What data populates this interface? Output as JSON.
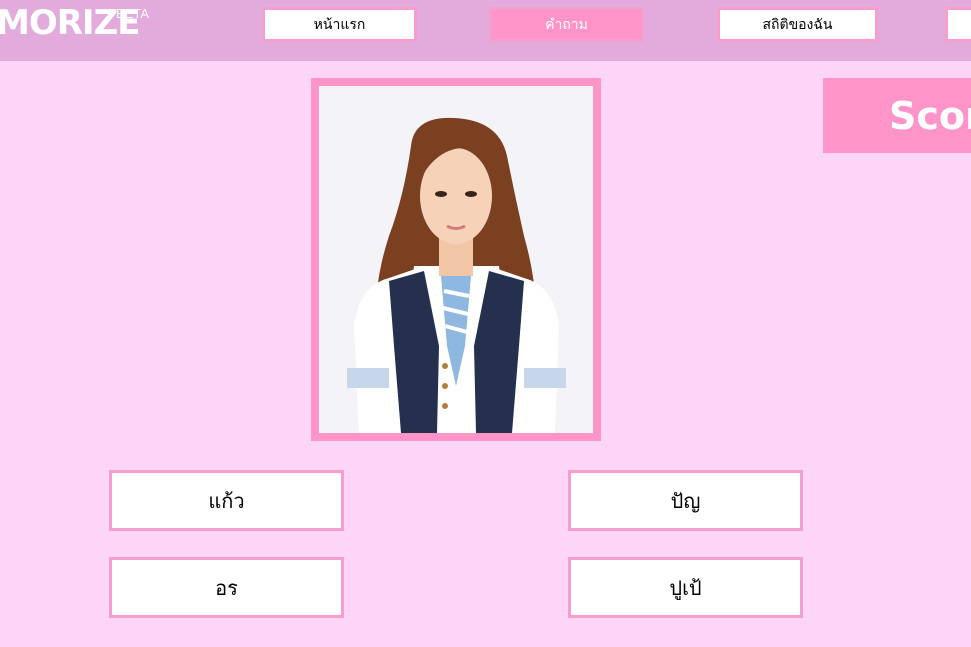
{
  "header": {
    "logo_text": "MORIZE",
    "logo_badge": "BETA",
    "nav": [
      {
        "label": "หน้าแรก",
        "active": false
      },
      {
        "label": "คำถาม",
        "active": true
      },
      {
        "label": "สถิติของฉัน",
        "active": false
      },
      {
        "label": "",
        "active": false
      }
    ]
  },
  "score": {
    "label": "Score"
  },
  "question": {
    "photo_icon": "member-portrait"
  },
  "answers": [
    {
      "label": "แก้ว"
    },
    {
      "label": "ปัญ"
    },
    {
      "label": "อร"
    },
    {
      "label": "ปูเป้"
    }
  ],
  "colors": {
    "background": "#fdd5f8",
    "header": "#e3abdb",
    "accent": "#ff94c8",
    "border": "#f59fce"
  }
}
